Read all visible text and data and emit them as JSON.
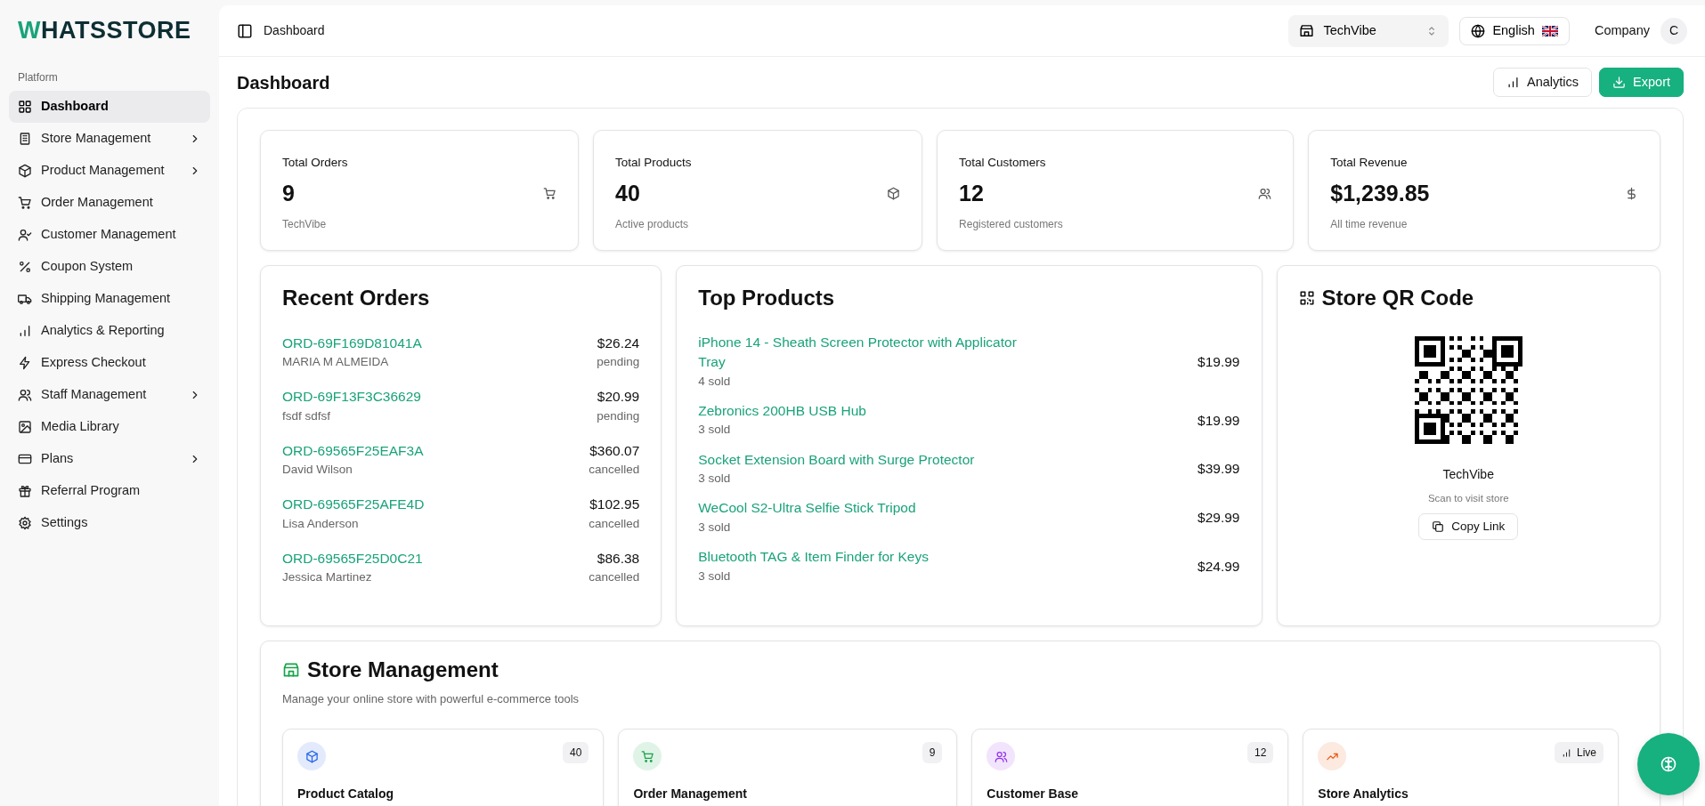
{
  "logo": {
    "text": "WHATSSTORE"
  },
  "sidebar": {
    "section": "Platform",
    "items": [
      {
        "label": "Dashboard",
        "selected": true,
        "expandable": false
      },
      {
        "label": "Store Management",
        "selected": false,
        "expandable": true
      },
      {
        "label": "Product Management",
        "selected": false,
        "expandable": true
      },
      {
        "label": "Order Management",
        "selected": false,
        "expandable": false
      },
      {
        "label": "Customer Management",
        "selected": false,
        "expandable": false
      },
      {
        "label": "Coupon System",
        "selected": false,
        "expandable": false
      },
      {
        "label": "Shipping Management",
        "selected": false,
        "expandable": false
      },
      {
        "label": "Analytics & Reporting",
        "selected": false,
        "expandable": false
      },
      {
        "label": "Express Checkout",
        "selected": false,
        "expandable": false
      },
      {
        "label": "Staff Management",
        "selected": false,
        "expandable": true
      },
      {
        "label": "Media Library",
        "selected": false,
        "expandable": false
      },
      {
        "label": "Plans",
        "selected": false,
        "expandable": true
      },
      {
        "label": "Referral Program",
        "selected": false,
        "expandable": false
      },
      {
        "label": "Settings",
        "selected": false,
        "expandable": false
      }
    ]
  },
  "topbar": {
    "breadcrumb": "Dashboard",
    "store_selector": "TechVibe",
    "language": "English",
    "account": "Company",
    "avatar": "C"
  },
  "page": {
    "title": "Dashboard",
    "buttons": [
      {
        "label": "Analytics",
        "kind": "outline"
      },
      {
        "label": "Export",
        "kind": "primary"
      }
    ]
  },
  "stats": [
    {
      "title": "Total Orders",
      "value": "9",
      "caption": "TechVibe"
    },
    {
      "title": "Total Products",
      "value": "40",
      "caption": "Active products"
    },
    {
      "title": "Total Customers",
      "value": "12",
      "caption": "Registered customers"
    },
    {
      "title": "Total Revenue",
      "value": "$1,239.85",
      "caption": "All time revenue"
    }
  ],
  "recent_orders": {
    "title": "Recent Orders",
    "orders": [
      {
        "id": "ORD-69F169D81041A",
        "customer": "MARIA M ALMEIDA",
        "amount": "$26.24",
        "status": "pending"
      },
      {
        "id": "ORD-69F13F3C36629",
        "customer": "fsdf sdfsf",
        "amount": "$20.99",
        "status": "pending"
      },
      {
        "id": "ORD-69565F25EAF3A",
        "customer": "David Wilson",
        "amount": "$360.07",
        "status": "cancelled"
      },
      {
        "id": "ORD-69565F25AFE4D",
        "customer": "Lisa Anderson",
        "amount": "$102.95",
        "status": "cancelled"
      },
      {
        "id": "ORD-69565F25D0C21",
        "customer": "Jessica Martinez",
        "amount": "$86.38",
        "status": "cancelled"
      }
    ]
  },
  "top_products": {
    "title": "Top Products",
    "items": [
      {
        "name": "iPhone 14 - Sheath Screen Protector with Applicator Tray",
        "sold": "4 sold",
        "price": "$19.99"
      },
      {
        "name": "Zebronics 200HB USB Hub",
        "sold": "3 sold",
        "price": "$19.99"
      },
      {
        "name": "Socket Extension Board with Surge Protector",
        "sold": "3 sold",
        "price": "$39.99"
      },
      {
        "name": "WeCool S2-Ultra Selfie Stick Tripod",
        "sold": "3 sold",
        "price": "$29.99"
      },
      {
        "name": "Bluetooth TAG & Item Finder for Keys",
        "sold": "3 sold",
        "price": "$24.99"
      }
    ]
  },
  "qr_card": {
    "title": "Store QR Code",
    "store_name": "TechVibe",
    "caption": "Scan to visit store",
    "button": "Copy Link"
  },
  "store_management": {
    "title": "Store Management",
    "subtitle": "Manage your online store with powerful e-commerce tools",
    "tiles": [
      {
        "title": "Product Catalog",
        "badge": "40",
        "kind": "count",
        "color": "#2563eb"
      },
      {
        "title": "Order Management",
        "badge": "9",
        "kind": "count",
        "color": "#16a34a"
      },
      {
        "title": "Customer Base",
        "badge": "12",
        "kind": "count",
        "color": "#9333ea"
      },
      {
        "title": "Store Analytics",
        "badge": "Live",
        "kind": "live",
        "color": "#ea580c"
      }
    ]
  }
}
